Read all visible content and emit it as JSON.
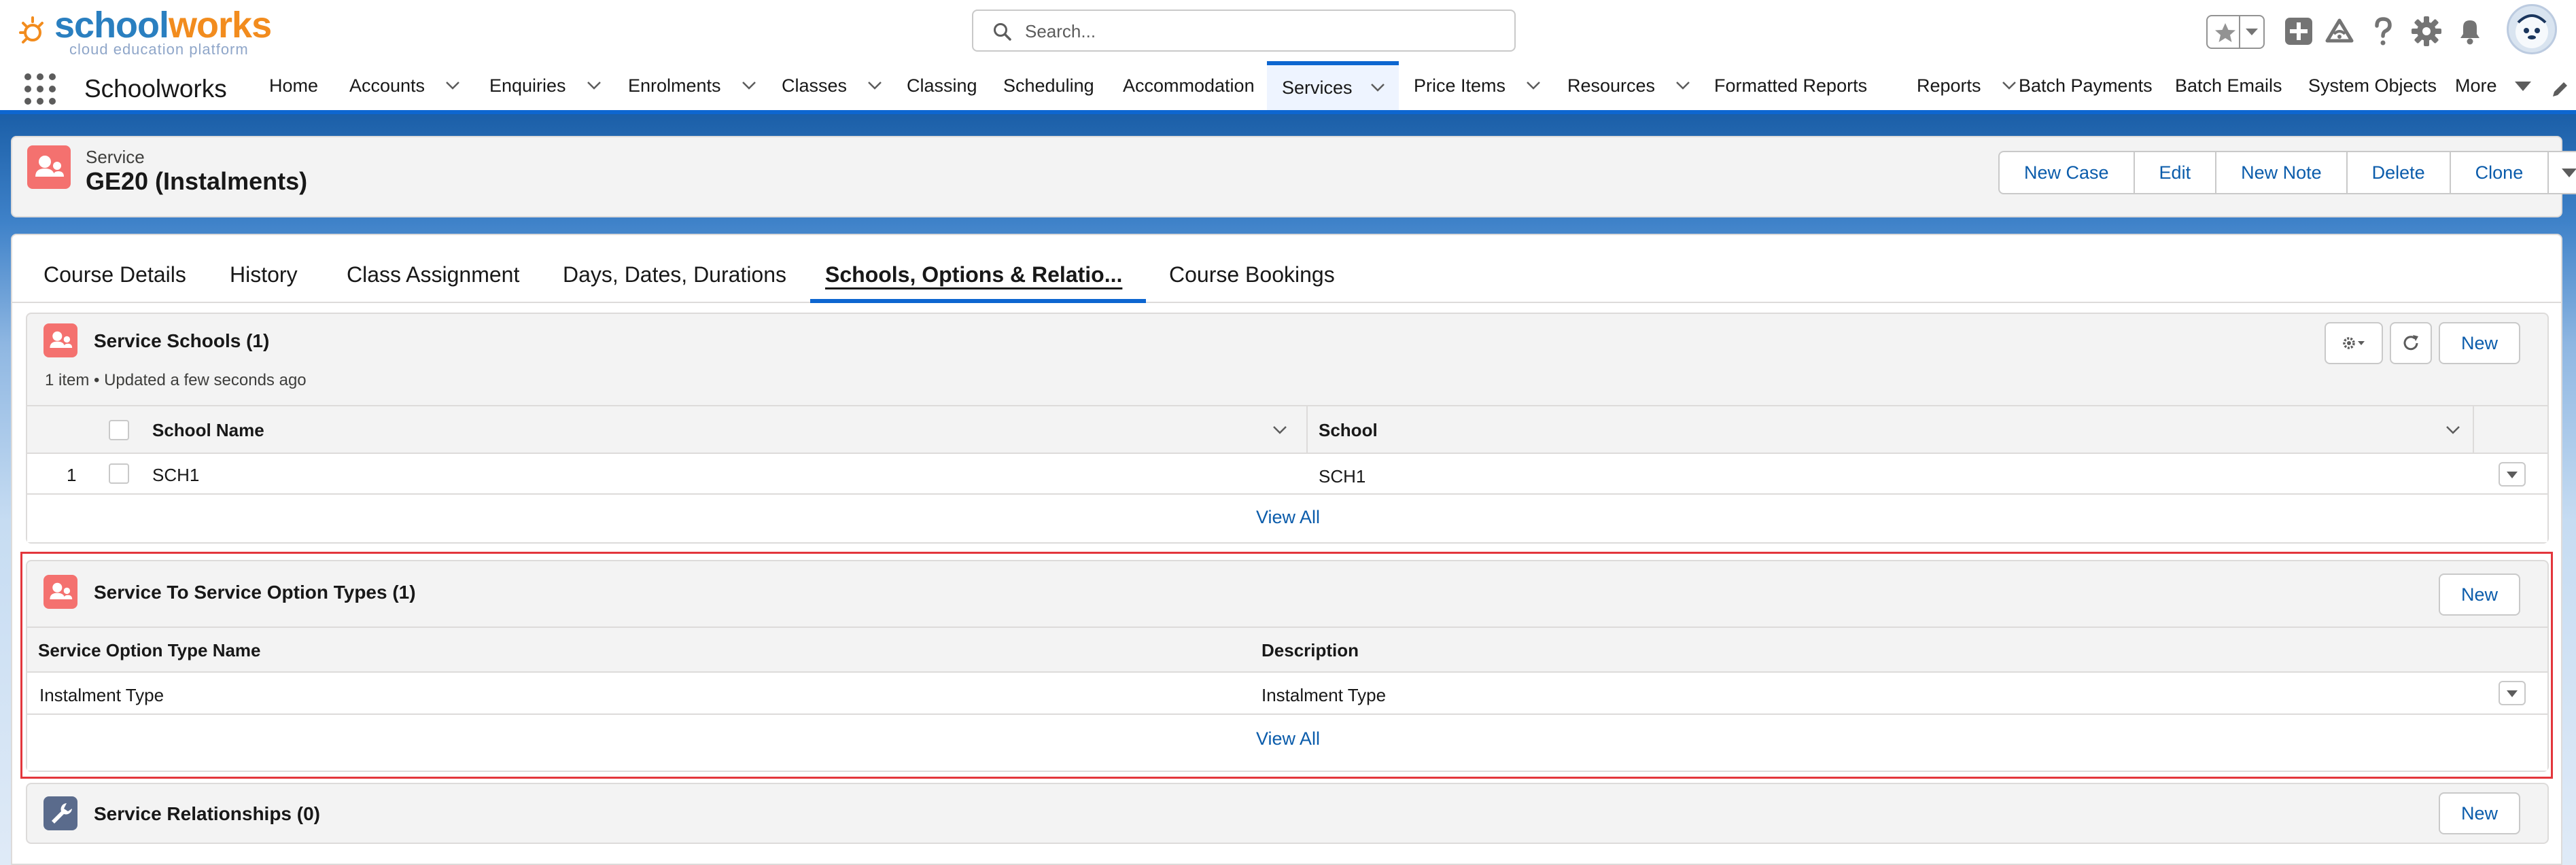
{
  "header": {
    "logo_text_school": "school",
    "logo_text_works": "works",
    "logo_tagline": "cloud education platform",
    "search_placeholder": "Search..."
  },
  "nav": {
    "app_name": "Schoolworks",
    "items": [
      {
        "label": "Home",
        "has_menu": false
      },
      {
        "label": "Accounts",
        "has_menu": true
      },
      {
        "label": "Enquiries",
        "has_menu": true
      },
      {
        "label": "Enrolments",
        "has_menu": true
      },
      {
        "label": "Classes",
        "has_menu": true
      },
      {
        "label": "Classing",
        "has_menu": false
      },
      {
        "label": "Scheduling",
        "has_menu": false
      },
      {
        "label": "Accommodation",
        "has_menu": false
      },
      {
        "label": "Services",
        "has_menu": true,
        "active": true
      },
      {
        "label": "Price Items",
        "has_menu": true
      },
      {
        "label": "Resources",
        "has_menu": true
      },
      {
        "label": "Formatted Reports",
        "has_menu": false
      },
      {
        "label": "Reports",
        "has_menu": true
      },
      {
        "label": "Batch Payments",
        "has_menu": false
      },
      {
        "label": "Batch Emails",
        "has_menu": false
      },
      {
        "label": "System Objects",
        "has_menu": false
      },
      {
        "label": "More",
        "has_menu": true
      }
    ]
  },
  "record": {
    "type": "Service",
    "title": "GE20 (Instalments)",
    "actions": [
      "New Case",
      "Edit",
      "New Note",
      "Delete",
      "Clone"
    ]
  },
  "tabs": [
    {
      "label": "Course Details"
    },
    {
      "label": "History"
    },
    {
      "label": "Class Assignment"
    },
    {
      "label": "Days, Dates, Durations"
    },
    {
      "label": "Schools, Options & Relatio...",
      "active": true
    },
    {
      "label": "Course Bookings"
    }
  ],
  "service_schools": {
    "title": "Service Schools (1)",
    "subtitle": "1 item • Updated a few seconds ago",
    "new_label": "New",
    "columns": [
      "School Name",
      "School"
    ],
    "rows": [
      {
        "num": "1",
        "school_name": "SCH1",
        "school": "SCH1"
      }
    ],
    "view_all": "View All"
  },
  "option_types": {
    "title": "Service To Service Option Types (1)",
    "new_label": "New",
    "columns": [
      "Service Option Type Name",
      "Description"
    ],
    "rows": [
      {
        "name": "Instalment Type",
        "description": "Instalment Type"
      }
    ],
    "view_all": "View All"
  },
  "relationships": {
    "title": "Service Relationships (0)",
    "new_label": "New"
  },
  "colors": {
    "brand_blue": "#0d66d0",
    "link_blue": "#0b5cab",
    "record_icon": "#f4716f",
    "highlight": "#e3363c"
  }
}
